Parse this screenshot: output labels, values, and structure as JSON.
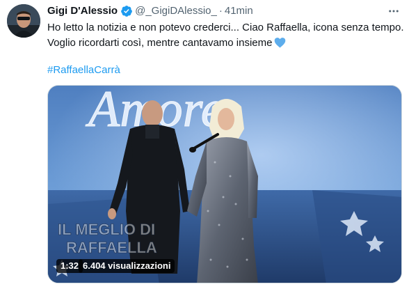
{
  "author": {
    "display_name": "Gigi D'Alessio",
    "handle": "@_GigiDAlessio_",
    "separator": "·",
    "time_ago": "41min",
    "verified": true
  },
  "tweet": {
    "text_line_1": "Ho letto la notizia e non potevo crederci... Ciao Raffaella, icona senza tempo.",
    "text_line_2": "Voglio ricordarti così, mentre cantavamo insieme",
    "emoji": "blue-heart-icon",
    "hashtag": "#RaffaellaCarrà"
  },
  "video": {
    "backdrop_text": "Amore",
    "overlay_caption_1": "IL MEGLIO DI",
    "overlay_caption_2": "RAFFAELLA",
    "duration": "1:32",
    "views": "6.404 visualizzazioni"
  },
  "icons": {
    "more": "more-horizontal-icon",
    "verified": "verified-badge-icon"
  },
  "colors": {
    "link": "#1d9bf0",
    "secondary_text": "#536471",
    "verified": "#1d9bf0"
  }
}
